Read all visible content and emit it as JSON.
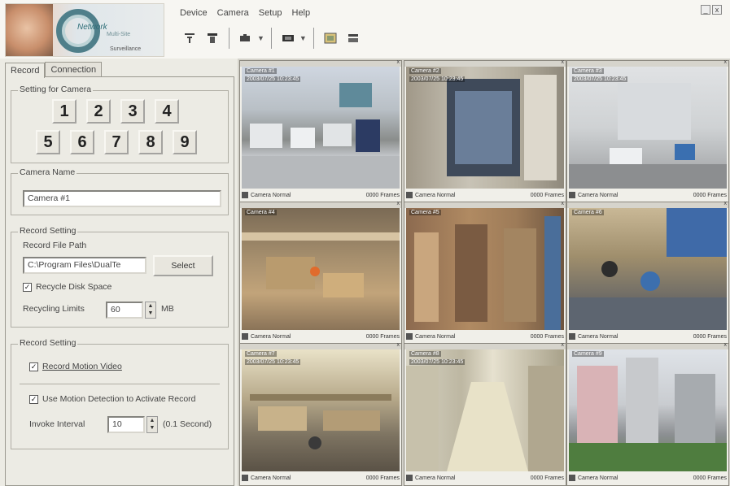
{
  "menu": [
    "Device",
    "Camera",
    "Setup",
    "Help"
  ],
  "logo": {
    "brand": "Network",
    "sub1": "Multi-Site",
    "sub2": "Surveillance"
  },
  "toolbar": {
    "icons": [
      "record-icon",
      "stop-icon",
      "camera-icon",
      "monitor-icon",
      "snapshot-icon",
      "settings-icon"
    ]
  },
  "window_buttons": [
    "_",
    "x"
  ],
  "tabs": [
    {
      "label": "Record",
      "active": true
    },
    {
      "label": "Connection",
      "active": false
    }
  ],
  "setting_camera": {
    "title": "Setting for Camera",
    "numbers": [
      "1",
      "2",
      "3",
      "4",
      "5",
      "6",
      "7",
      "8",
      "9"
    ]
  },
  "camera_name": {
    "title": "Camera Name",
    "value": "Camera #1"
  },
  "record_setting_1": {
    "title": "Record Setting",
    "path_label": "Record File Path",
    "path_value": "C:\\Program Files\\DualTe",
    "select_button": "Select",
    "recycle_label": "Recycle Disk Space",
    "recycling_limit_label": "Recycling Limits",
    "recycling_limit_value": "60",
    "recycling_unit": "MB"
  },
  "record_setting_2": {
    "title": "Record Setting",
    "motion_video_label": "Record Motion Video",
    "use_motion_label": "Use Motion Detection to Activate Record",
    "interval_label": "Invoke Interval",
    "interval_value": "10",
    "interval_unit": "(0.1 Second)"
  },
  "cameras": [
    {
      "osd1": "Camera #1",
      "osd2": "2003/07/25 10:23:45"
    },
    {
      "osd1": "Camera #2",
      "osd2": "2003/07/25 10:23:45"
    },
    {
      "osd1": "Camera #3",
      "osd2": "2003/07/25 10:23:45"
    },
    {
      "osd1": "Camera #4",
      "osd2": ""
    },
    {
      "osd1": "Camera #5",
      "osd2": ""
    },
    {
      "osd1": "Camera #6",
      "osd2": ""
    },
    {
      "osd1": "Camera #7",
      "osd2": "2003/07/25 10:23:45"
    },
    {
      "osd1": "Camera #8",
      "osd2": "2003/07/25 10:23:45"
    },
    {
      "osd1": "Camera #9",
      "osd2": ""
    }
  ],
  "camera_status": {
    "left": "Camera Normal",
    "right": "0000 Frames"
  }
}
